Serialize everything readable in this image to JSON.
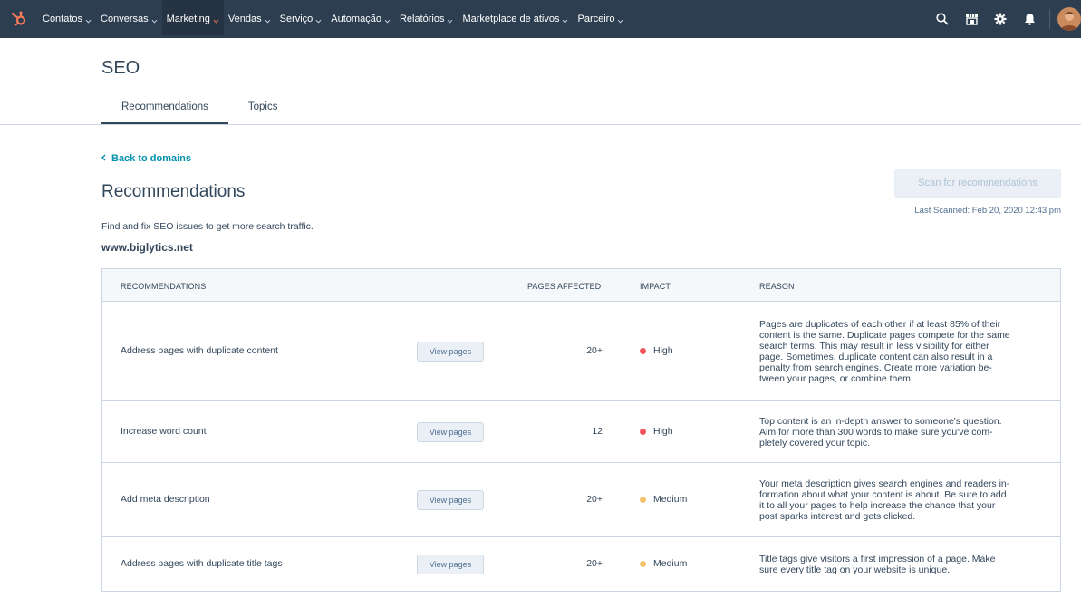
{
  "nav": {
    "items": [
      {
        "label": "Contatos",
        "active": false
      },
      {
        "label": "Conversas",
        "active": false
      },
      {
        "label": "Marketing",
        "active": true
      },
      {
        "label": "Vendas",
        "active": false
      },
      {
        "label": "Serviço",
        "active": false
      },
      {
        "label": "Automação",
        "active": false
      },
      {
        "label": "Relatórios",
        "active": false
      },
      {
        "label": "Marketplace de ativos",
        "active": false
      },
      {
        "label": "Parceiro",
        "active": false
      }
    ],
    "icons": [
      "search-icon",
      "marketplace-icon",
      "settings-icon",
      "notifications-icon"
    ],
    "accent_color": "#ff7a59"
  },
  "page": {
    "title": "SEO",
    "tabs": [
      {
        "label": "Recommendations",
        "active": true
      },
      {
        "label": "Topics",
        "active": false
      }
    ]
  },
  "content": {
    "back_link": "Back to domains",
    "section_title": "Recommendations",
    "scan_button": "Scan for recommendations",
    "last_scanned": "Last Scanned: Feb 20, 2020 12:43 pm",
    "description": "Find and fix SEO issues to get more search traffic.",
    "domain": "www.biglytics.net"
  },
  "table": {
    "headers": {
      "recommendations": "RECOMMENDATIONS",
      "pages_affected": "PAGES AFFECTED",
      "impact": "IMPACT",
      "reason": "REASON"
    },
    "view_label": "View pages",
    "rows": [
      {
        "name": "Address pages with duplicate content",
        "pages": "20+",
        "impact": "High",
        "impact_color": "#f2545b",
        "reason": [
          "Pages are duplicates of each other if at least 85% of their",
          "content is the same. Duplicate pages compete for the same",
          "search terms. This may result in less visibility for either",
          "page. Sometimes, duplicate content can also result in a",
          "penalty from search engines. Create more variation be-",
          "tween your pages, or combine them."
        ]
      },
      {
        "name": "Increase word count",
        "pages": "12",
        "impact": "High",
        "impact_color": "#f2545b",
        "reason": [
          "Top content is an in-depth answer to someone's question.",
          "Aim for more than 300 words to make sure you've com-",
          "pletely covered your topic."
        ]
      },
      {
        "name": "Add meta description",
        "pages": "20+",
        "impact": "Medium",
        "impact_color": "#f5c26b",
        "reason": [
          "Your meta description gives search engines and readers in-",
          "formation about what your content is about. Be sure to add",
          "it to all your pages to help increase the chance that your",
          "post sparks interest and gets clicked."
        ]
      },
      {
        "name": "Address pages with duplicate title tags",
        "pages": "20+",
        "impact": "Medium",
        "impact_color": "#f5c26b",
        "reason": [
          "Title tags give visitors a first impression of a page. Make",
          "sure every title tag on your website is unique."
        ]
      }
    ]
  }
}
